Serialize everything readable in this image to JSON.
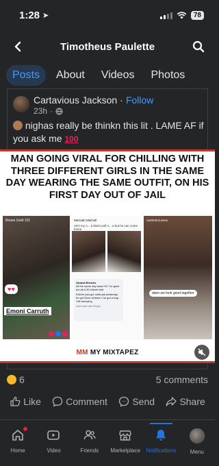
{
  "status": {
    "time": "1:28",
    "battery": "78"
  },
  "header": {
    "title": "Timotheus Paulette"
  },
  "tabs": [
    {
      "label": "Posts"
    },
    {
      "label": "About"
    },
    {
      "label": "Videos"
    },
    {
      "label": "Photos"
    }
  ],
  "post": {
    "author": "Cartavious Jackson",
    "separator": "·",
    "follow_label": "Follow",
    "time": "23h",
    "dot": "·",
    "text": "nighas really be thinkn this lit . LAME AF if you ask me",
    "emoji_100": "100",
    "image": {
      "headline": "MAN GOING VIRAL FOR CHILLING WITH THREE DIFFERENT GIRLS IN THE SAME DAY WEARING THE SAME OUTFIT, ON HIS FIRST DAY OUT OF JAIL",
      "panel1_top": "Rosee Gold 101",
      "hearts": "♥♥",
      "name_tag": "Emoni Carruth",
      "panel2_head": "Messiah Mitchell",
      "panel2_caption": "Ain't my n... a that's poll n... a but he can come home",
      "comment_name": "Janasa Browns",
      "comment_text": "All the same day same fit ? he goes am all a 30 minute trial",
      "comment_text2": "Edit:he just got outta jail yesterday he got More clothes n he got a bag . Yall annoying",
      "comment_actions": "Just now   Like   Reply",
      "panel3_head": "ruethebroussee",
      "bubble": "dann we look good together",
      "logo_text": "MY MIXTAPEZ",
      "logo_mark": "MM"
    },
    "reaction_count": "6",
    "comments_count": "5 comments"
  },
  "actions": [
    {
      "label": "Like",
      "icon": "like-icon"
    },
    {
      "label": "Comment",
      "icon": "comment-icon"
    },
    {
      "label": "Send",
      "icon": "messenger-icon"
    },
    {
      "label": "Share",
      "icon": "share-icon"
    }
  ],
  "nav": [
    {
      "label": "Home",
      "icon": "home-icon"
    },
    {
      "label": "Video",
      "icon": "video-icon"
    },
    {
      "label": "Friends",
      "icon": "friends-icon"
    },
    {
      "label": "Marketplace",
      "icon": "marketplace-icon"
    },
    {
      "label": "Notifications",
      "icon": "bell-icon"
    },
    {
      "label": "Menu",
      "icon": "menu-avatar"
    }
  ],
  "colors": {
    "accent": "#2374e1",
    "link": "#4599ff",
    "background": "#242526",
    "banner_border": "#c0392b"
  }
}
